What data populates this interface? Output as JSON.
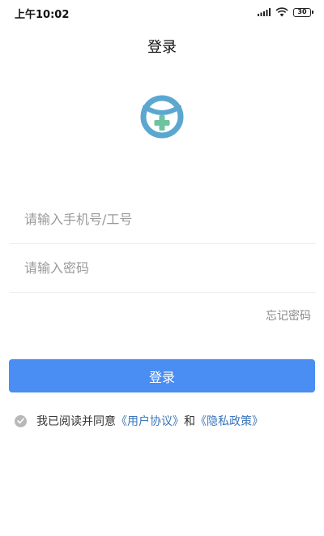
{
  "status_bar": {
    "time": "上午10:02",
    "battery": "30",
    "icons": [
      "signal-icon",
      "wifi-icon",
      "battery-icon"
    ]
  },
  "header": {
    "title": "登录"
  },
  "logo": {
    "icon": "app-logo-icon",
    "colors": {
      "ring": "#5ba7d0",
      "cross": "#6ec3a0"
    }
  },
  "form": {
    "phone_placeholder": "请输入手机号/工号",
    "phone_value": "",
    "password_placeholder": "请输入密码",
    "password_value": "",
    "forgot_label": "忘记密码",
    "login_label": "登录"
  },
  "agreement": {
    "checked_icon": "check-circle-icon",
    "prefix": "我已阅读并同意",
    "user_agreement": "《用户协议》",
    "conjunction": "和",
    "privacy_policy": "《隐私政策》"
  },
  "colors": {
    "primary": "#4a8ef3",
    "link": "#3a75b9",
    "placeholder": "#9a9a9a"
  }
}
